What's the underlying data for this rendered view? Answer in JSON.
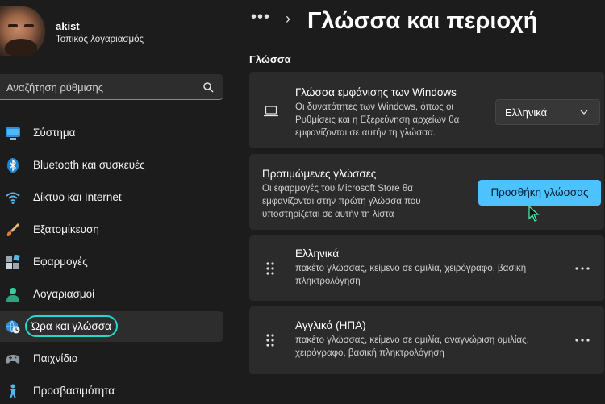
{
  "user": {
    "name": "akist",
    "account_type": "Τοπικός λογαριασμός"
  },
  "search": {
    "placeholder": "Αναζήτηση ρύθμισης"
  },
  "nav": {
    "items": [
      {
        "label": "Σύστημα",
        "icon": "system-icon"
      },
      {
        "label": "Bluetooth και συσκευές",
        "icon": "bluetooth-icon"
      },
      {
        "label": "Δίκτυο και Internet",
        "icon": "wifi-icon"
      },
      {
        "label": "Εξατομίκευση",
        "icon": "brush-icon"
      },
      {
        "label": "Εφαρμογές",
        "icon": "apps-icon"
      },
      {
        "label": "Λογαριασμοί",
        "icon": "person-icon"
      },
      {
        "label": "Ώρα και γλώσσα",
        "icon": "globe-clock-icon",
        "active": true
      },
      {
        "label": "Παιχνίδια",
        "icon": "gamepad-icon"
      },
      {
        "label": "Προσβασιμότητα",
        "icon": "accessibility-icon"
      }
    ]
  },
  "breadcrumb": {
    "dots": "•••",
    "separator": "›",
    "title": "Γλώσσα και περιοχή"
  },
  "language_section": {
    "title": "Γλώσσα",
    "display_language": {
      "title": "Γλώσσα εμφάνισης των Windows",
      "description": "Οι δυνατότητες των Windows, όπως οι Ρυθμίσεις και η Εξερεύνηση αρχείων θα εμφανίζονται σε αυτήν τη γλώσσα.",
      "selected": "Ελληνικά"
    },
    "preferred_languages": {
      "title": "Προτιμώμενες γλώσσες",
      "description": "Οι εφαρμογές του Microsoft Store θα εμφανίζονται στην πρώτη γλώσσα που υποστηρίζεται σε αυτήν τη λίστα",
      "add_button": "Προσθήκη γλώσσας"
    },
    "languages": [
      {
        "name": "Ελληνικά",
        "features": "πακέτο γλώσσας, κείμενο σε ομιλία, χειρόγραφο, βασική πληκτρολόγηση"
      },
      {
        "name": "Αγγλικά (ΗΠΑ)",
        "features": "πακέτο γλώσσας, κείμενο σε ομιλία, αναγνώριση ομιλίας, χειρόγραφο, βασική πληκτρολόγηση"
      }
    ]
  },
  "colors": {
    "accent": "#4cc2ff",
    "highlight_ring": "#25d9d0",
    "background": "#1c1c1c",
    "card": "#2b2b2b"
  }
}
